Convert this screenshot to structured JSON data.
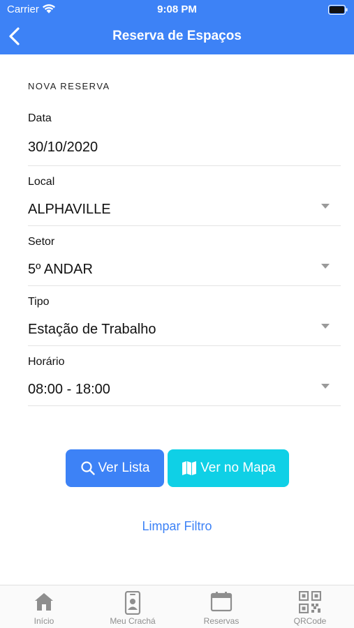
{
  "status_bar": {
    "carrier": "Carrier",
    "time": "9:08 PM"
  },
  "nav": {
    "title": "Reserva de Espaços",
    "back_icon": "chevron-left-icon"
  },
  "form": {
    "section_title": "NOVA RESERVA",
    "fields": [
      {
        "label": "Data",
        "value": "30/10/2020"
      },
      {
        "label": "Local",
        "value": "ALPHAVILLE"
      },
      {
        "label": "Setor",
        "value": "5º ANDAR"
      },
      {
        "label": "Tipo",
        "value": "Estação de Trabalho"
      },
      {
        "label": "Horário",
        "value": "08:00 - 18:00"
      }
    ]
  },
  "actions": {
    "list_label": "Ver Lista",
    "map_label": "Ver no Mapa",
    "clear_label": "Limpar Filtro"
  },
  "tabs": [
    {
      "label": "Início",
      "icon": "home-icon"
    },
    {
      "label": "Meu Crachá",
      "icon": "badge-icon"
    },
    {
      "label": "Reservas",
      "icon": "calendar-icon"
    },
    {
      "label": "QRCode",
      "icon": "qrcode-icon"
    }
  ],
  "colors": {
    "primary": "#3d82f6",
    "map_button": "#0fd0e6",
    "tab_inactive": "#8e8e8e"
  }
}
